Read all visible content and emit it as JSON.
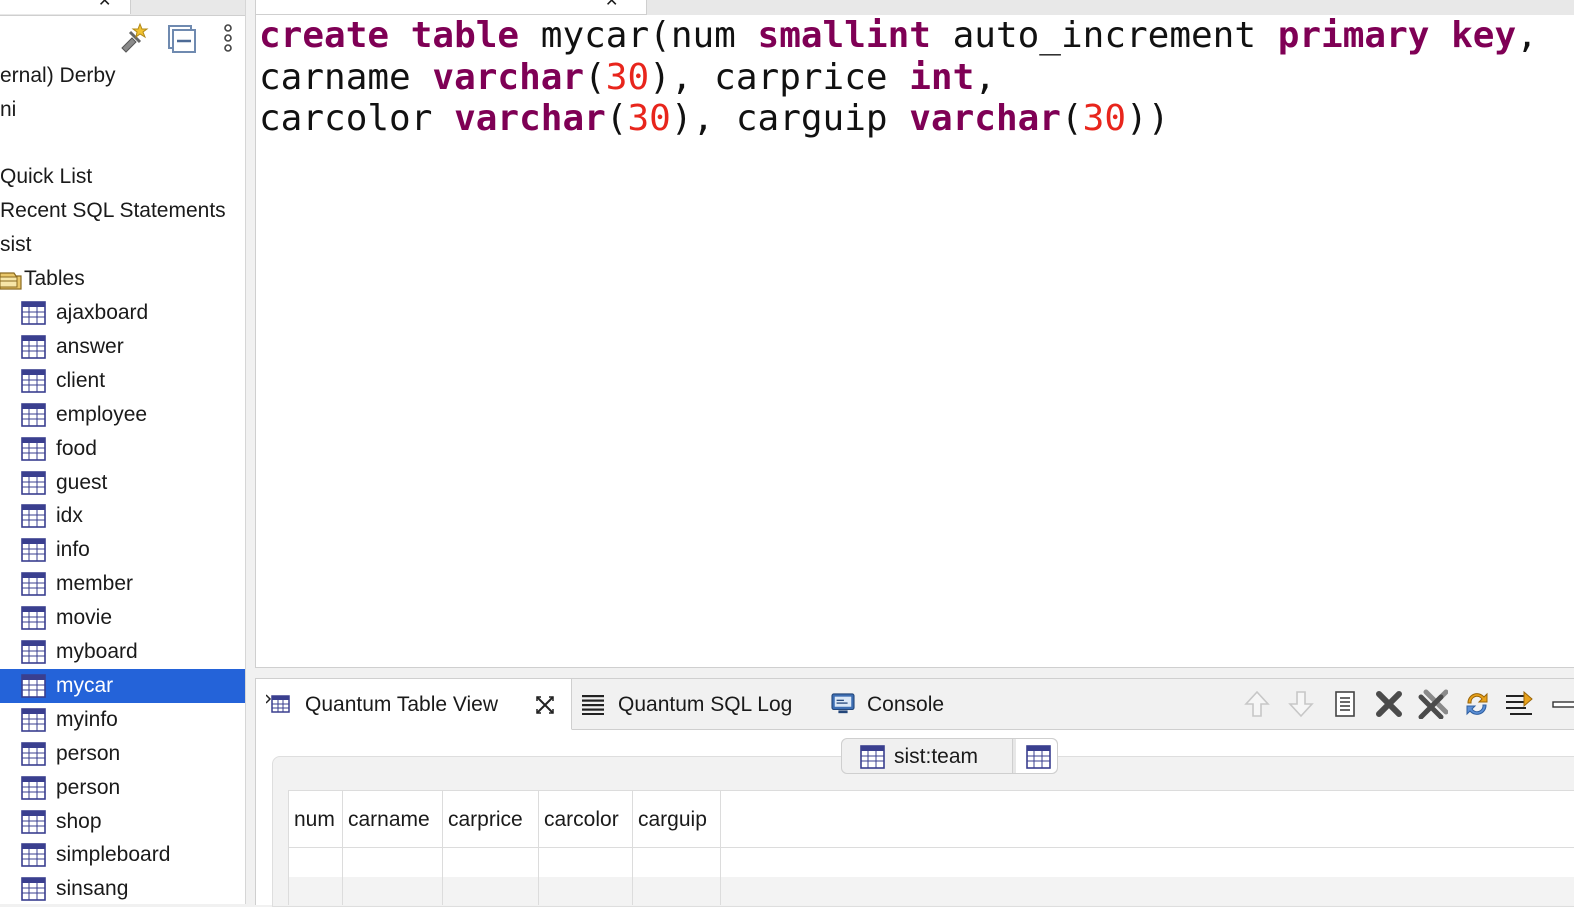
{
  "left_panel": {
    "items": [
      {
        "label": "ernal) Derby"
      },
      {
        "label": "ni"
      },
      {
        "label": "Quick List"
      },
      {
        "label": "Recent SQL Statements"
      },
      {
        "label": "sist"
      },
      {
        "label": "Tables"
      }
    ],
    "tables": [
      {
        "label": "ajaxboard"
      },
      {
        "label": "answer"
      },
      {
        "label": "client"
      },
      {
        "label": "employee"
      },
      {
        "label": "food"
      },
      {
        "label": "guest"
      },
      {
        "label": "idx"
      },
      {
        "label": "info"
      },
      {
        "label": "member"
      },
      {
        "label": "movie"
      },
      {
        "label": "myboard"
      },
      {
        "label": "mycar",
        "selected": true
      },
      {
        "label": "myinfo"
      },
      {
        "label": "person"
      },
      {
        "label": "person"
      },
      {
        "label": "shop"
      },
      {
        "label": "simpleboard"
      },
      {
        "label": "sinsang"
      }
    ]
  },
  "editor": {
    "sql": {
      "line1": {
        "t1": "create",
        "t2": " ",
        "t3": "table",
        "t4": " mycar(num ",
        "t5": "smallint",
        "t6": " auto_increment ",
        "t7": "primary",
        "t8": " ",
        "t9": "key",
        "t10": ","
      },
      "line2": {
        "t1": "carname ",
        "t2": "varchar",
        "t3": "(",
        "t4": "30",
        "t5": "), carprice ",
        "t6": "int",
        "t7": ","
      },
      "line3": {
        "t1": "carcolor ",
        "t2": "varchar",
        "t3": "(",
        "t4": "30",
        "t5": "), carguip ",
        "t6": "varchar",
        "t7": "(",
        "t8": "30",
        "t9": "))"
      }
    }
  },
  "bottom": {
    "tabs": [
      {
        "label": "Quantum Table View",
        "active": true
      },
      {
        "label": "Quantum SQL Log"
      },
      {
        "label": "Console"
      }
    ],
    "subtab_label": "sist:team",
    "columns": [
      "num",
      "carname",
      "carprice",
      "carcolor",
      "carguip"
    ]
  },
  "colors": {
    "keyword": "#7f0055",
    "number": "#e8251c",
    "selection": "#2463d9"
  },
  "icons": [
    "new-bookmark-icon",
    "collapse-all-icon",
    "view-menu-icon",
    "table-icon",
    "tables-folder-icon",
    "sql-log-icon",
    "console-icon",
    "move-up-icon",
    "move-down-icon",
    "document-icon",
    "delete-icon",
    "delete-all-icon",
    "refresh-icon",
    "transfer-icon",
    "minimize-icon",
    "close-icon"
  ]
}
